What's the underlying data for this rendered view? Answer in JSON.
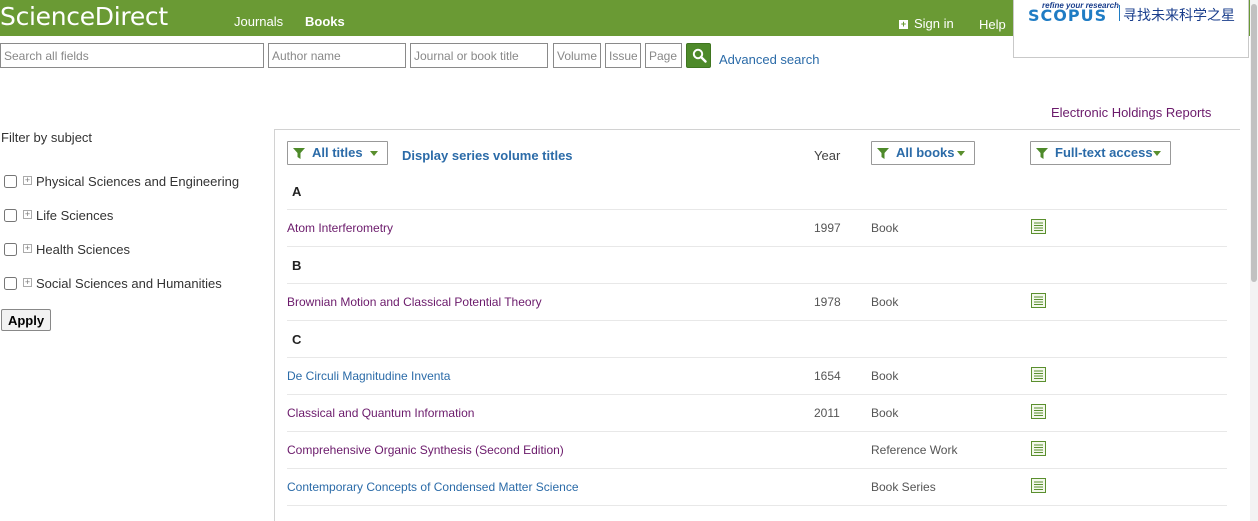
{
  "header": {
    "logo": "ScienceDirect",
    "nav": [
      "Journals",
      "Books"
    ],
    "sign_in": "Sign in",
    "help": "Help",
    "scopus": {
      "tagline": "refine your research",
      "wordmark": "SCOPUS",
      "slogan": "寻找未来科学之星"
    }
  },
  "search": {
    "all_fields_placeholder": "Search all fields",
    "author_placeholder": "Author name",
    "journal_placeholder": "Journal or book title",
    "volume_placeholder": "Volume",
    "issue_placeholder": "Issue",
    "page_placeholder": "Page",
    "advanced": "Advanced search"
  },
  "reports_link": "Electronic Holdings Reports",
  "filter": {
    "title": "Filter by subject",
    "subjects": [
      "Physical Sciences and Engineering",
      "Life Sciences",
      "Health Sciences",
      "Social Sciences and Humanities"
    ],
    "apply": "Apply"
  },
  "list": {
    "titles_filter": "All titles",
    "series_link": "Display series volume titles",
    "year_header": "Year",
    "books_filter": "All books",
    "access_filter": "Full-text access",
    "groups": [
      {
        "letter": "A",
        "items": [
          {
            "title": "Atom Interferometry",
            "year": "1997",
            "type": "Book",
            "color": "purple"
          }
        ]
      },
      {
        "letter": "B",
        "items": [
          {
            "title": "Brownian Motion and Classical Potential Theory",
            "year": "1978",
            "type": "Book",
            "color": "purple"
          }
        ]
      },
      {
        "letter": "C",
        "items": [
          {
            "title": "De Circuli Magnitudine Inventa",
            "year": "1654",
            "type": "Book",
            "color": "blue"
          },
          {
            "title": "Classical and Quantum Information",
            "year": "2011",
            "type": "Book",
            "color": "purple"
          },
          {
            "title": "Comprehensive Organic Synthesis (Second Edition)",
            "year": "",
            "type": "Reference Work",
            "color": "purple"
          },
          {
            "title": "Contemporary Concepts of Condensed Matter Science",
            "year": "",
            "type": "Book Series",
            "color": "blue"
          }
        ]
      }
    ]
  },
  "colors": {
    "header_green": "#6a9a34",
    "link_blue": "#2b6ba8",
    "visited_purple": "#6b1a6b"
  }
}
